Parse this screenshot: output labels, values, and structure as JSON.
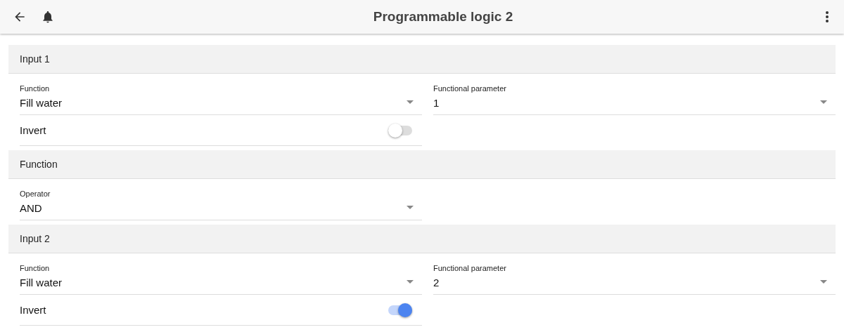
{
  "app_bar": {
    "title": "Programmable logic 2"
  },
  "sections": [
    {
      "title": "Input 1",
      "fields": [
        {
          "kind": "select",
          "label": "Function",
          "value": "Fill water"
        },
        {
          "kind": "select",
          "label": "Functional parameter",
          "value": "1"
        },
        {
          "kind": "toggle",
          "label": "Invert",
          "on": false
        }
      ]
    },
    {
      "title": "Function",
      "fields": [
        {
          "kind": "select",
          "label": "Operator",
          "value": "AND"
        }
      ]
    },
    {
      "title": "Input 2",
      "fields": [
        {
          "kind": "select",
          "label": "Function",
          "value": "Fill water"
        },
        {
          "kind": "select",
          "label": "Functional parameter",
          "value": "2"
        },
        {
          "kind": "toggle",
          "label": "Invert",
          "on": true
        }
      ]
    }
  ]
}
